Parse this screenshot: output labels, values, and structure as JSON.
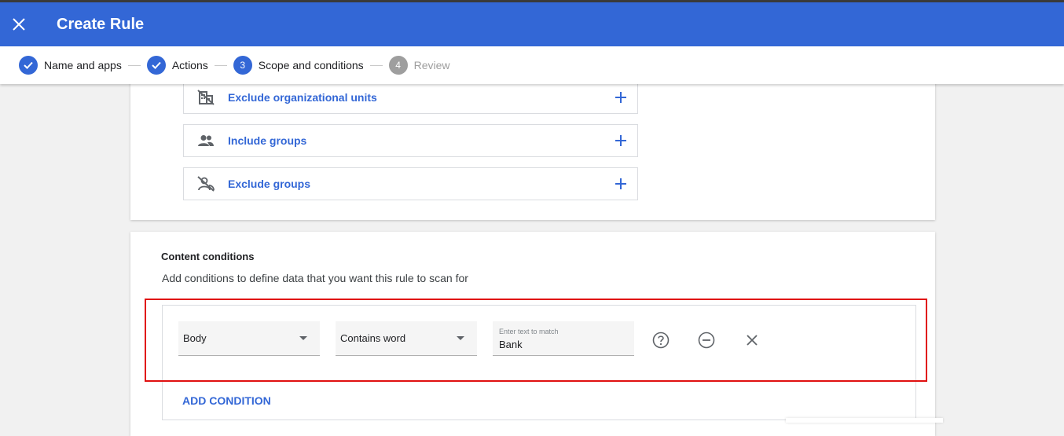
{
  "appbar": {
    "title": "Create Rule"
  },
  "stepper": {
    "steps": [
      {
        "label": "Name and apps",
        "state": "done",
        "number": ""
      },
      {
        "label": "Actions",
        "state": "done",
        "number": ""
      },
      {
        "label": "Scope and conditions",
        "state": "current",
        "number": "3"
      },
      {
        "label": "Review",
        "state": "pending",
        "number": "4"
      }
    ]
  },
  "scope": {
    "rows": [
      {
        "label": "Exclude organizational units",
        "icon": "exclude-org-unit-icon"
      },
      {
        "label": "Include groups",
        "icon": "group-icon"
      },
      {
        "label": "Exclude groups",
        "icon": "exclude-group-icon"
      }
    ]
  },
  "content_conditions": {
    "title": "Content conditions",
    "description": "Add conditions to define data that you want this rule to scan for",
    "condition": {
      "field": "Body",
      "operator": "Contains word",
      "value_placeholder": "Enter text to match",
      "value": "Bank"
    },
    "add_condition_label": "ADD CONDITION"
  },
  "colors": {
    "primary": "#3367d6",
    "highlight": "#e01010",
    "pending": "#9e9e9e"
  }
}
